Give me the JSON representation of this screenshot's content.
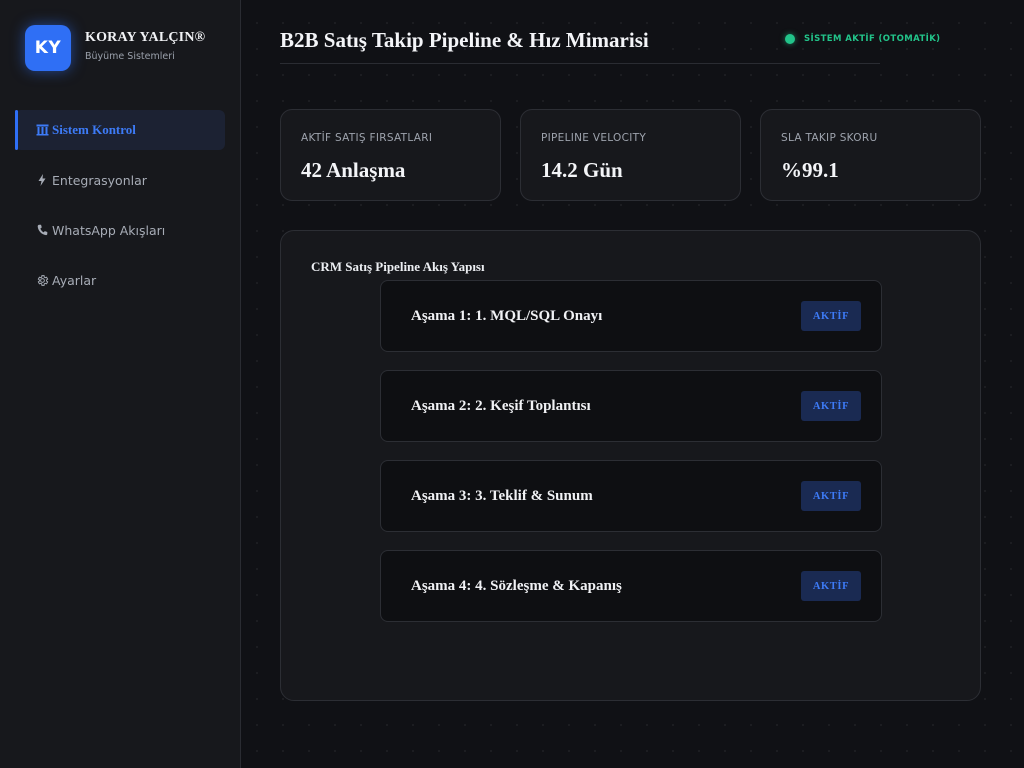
{
  "brand": {
    "logo_text": "KY",
    "name": "KORAY YALÇIN®",
    "subtitle": "Büyüme Sistemleri"
  },
  "sidebar": {
    "items": [
      {
        "label": "Sistem Kontrol",
        "icon": "building-columns-icon",
        "active": true
      },
      {
        "label": "Entegrasyonlar",
        "icon": "lightning-icon",
        "active": false
      },
      {
        "label": "WhatsApp Akışları",
        "icon": "phone-icon",
        "active": false
      },
      {
        "label": "Ayarlar",
        "icon": "gear-icon",
        "active": false
      }
    ]
  },
  "header": {
    "title": "B2B Satış Takip Pipeline & Hız Mimarisi",
    "status_text": "SİSTEM AKTİF (OTOMATİK)"
  },
  "metrics": [
    {
      "label": "AKTİF SATIŞ FIRSATLARI",
      "value": "42 Anlaşma"
    },
    {
      "label": "PIPELINE VELOCITY",
      "value": "14.2 Gün"
    },
    {
      "label": "SLA TAKIP SKORU",
      "value": "%99.1"
    }
  ],
  "pipeline": {
    "title": "CRM Satış Pipeline Akış Yapısı",
    "stages": [
      {
        "label": "Aşama 1: 1. MQL/SQL Onayı",
        "badge": "AKTİF"
      },
      {
        "label": "Aşama 2: 2. Keşif Toplantısı",
        "badge": "AKTİF"
      },
      {
        "label": "Aşama 3: 3. Teklif & Sunum",
        "badge": "AKTİF"
      },
      {
        "label": "Aşama 4: 4. Sözleşme & Kapanış",
        "badge": "AKTİF"
      }
    ]
  },
  "colors": {
    "accent": "#2f6ff5",
    "status_green": "#22c48a",
    "background": "#101115",
    "card": "#17181c"
  }
}
